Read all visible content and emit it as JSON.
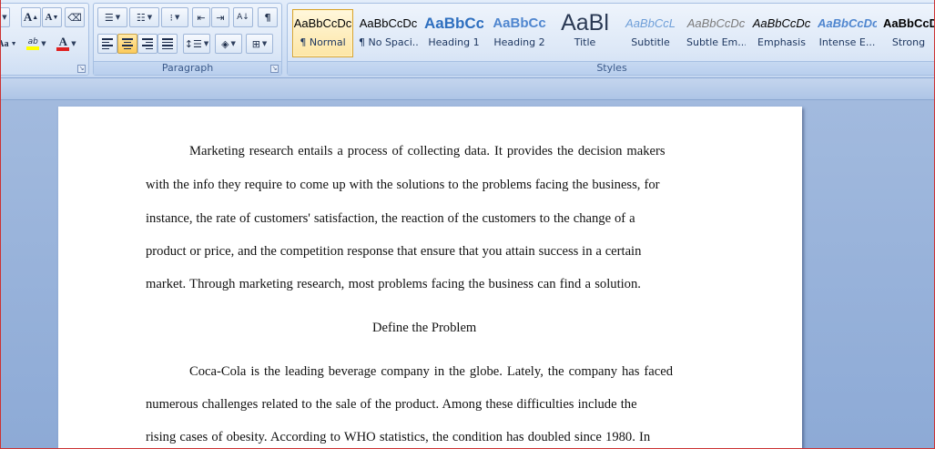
{
  "ribbon": {
    "font_group": {
      "grow_font_label": "A",
      "shrink_font_label": "A",
      "change_case_label": "Aa",
      "highlight_label": "ab",
      "font_color_label": "A"
    },
    "paragraph": {
      "label": "Paragraph",
      "show_marks_label": "¶"
    },
    "styles": {
      "label": "Styles",
      "items": [
        {
          "preview": "AaBbCcDc",
          "name": "¶ Normal"
        },
        {
          "preview": "AaBbCcDc",
          "name": "¶ No Spaci..."
        },
        {
          "preview": "AaBbCc",
          "name": "Heading 1"
        },
        {
          "preview": "AaBbCc",
          "name": "Heading 2"
        },
        {
          "preview": "AaBl",
          "name": "Title"
        },
        {
          "preview": "AaBbCcL",
          "name": "Subtitle"
        },
        {
          "preview": "AaBbCcDc",
          "name": "Subtle Em..."
        },
        {
          "preview": "AaBbCcDc",
          "name": "Emphasis"
        },
        {
          "preview": "AaBbCcDc",
          "name": "Intense E..."
        },
        {
          "preview": "AaBbCcDc",
          "name": "Strong"
        }
      ]
    }
  },
  "document": {
    "lines": [
      "Marketing research entails a process of collecting data. It provides the decision makers",
      "with the info they require to come up with the solutions to the problems facing the business, for",
      "instance, the rate of customers' satisfaction, the reaction of the customers to the change of a",
      "product or price, and the competition response that ensure that you attain success in a certain",
      "market. Through marketing research, most problems facing the business can find a solution.",
      "Define the Problem",
      "Coca-Cola is the leading beverage company in the globe. Lately, the company has faced",
      "numerous challenges related to the sale of the product. Among these difficulties include the",
      "rising cases of obesity. According to WHO statistics, the condition has doubled since 1980. In"
    ]
  },
  "colors": {
    "ribbon_bg": "#d5e3f6",
    "workspace_bg": "#a4bbdd",
    "selected_style": "#fde6a5",
    "font_color_bar": "#e02020",
    "highlight_bar": "#ffff00"
  }
}
